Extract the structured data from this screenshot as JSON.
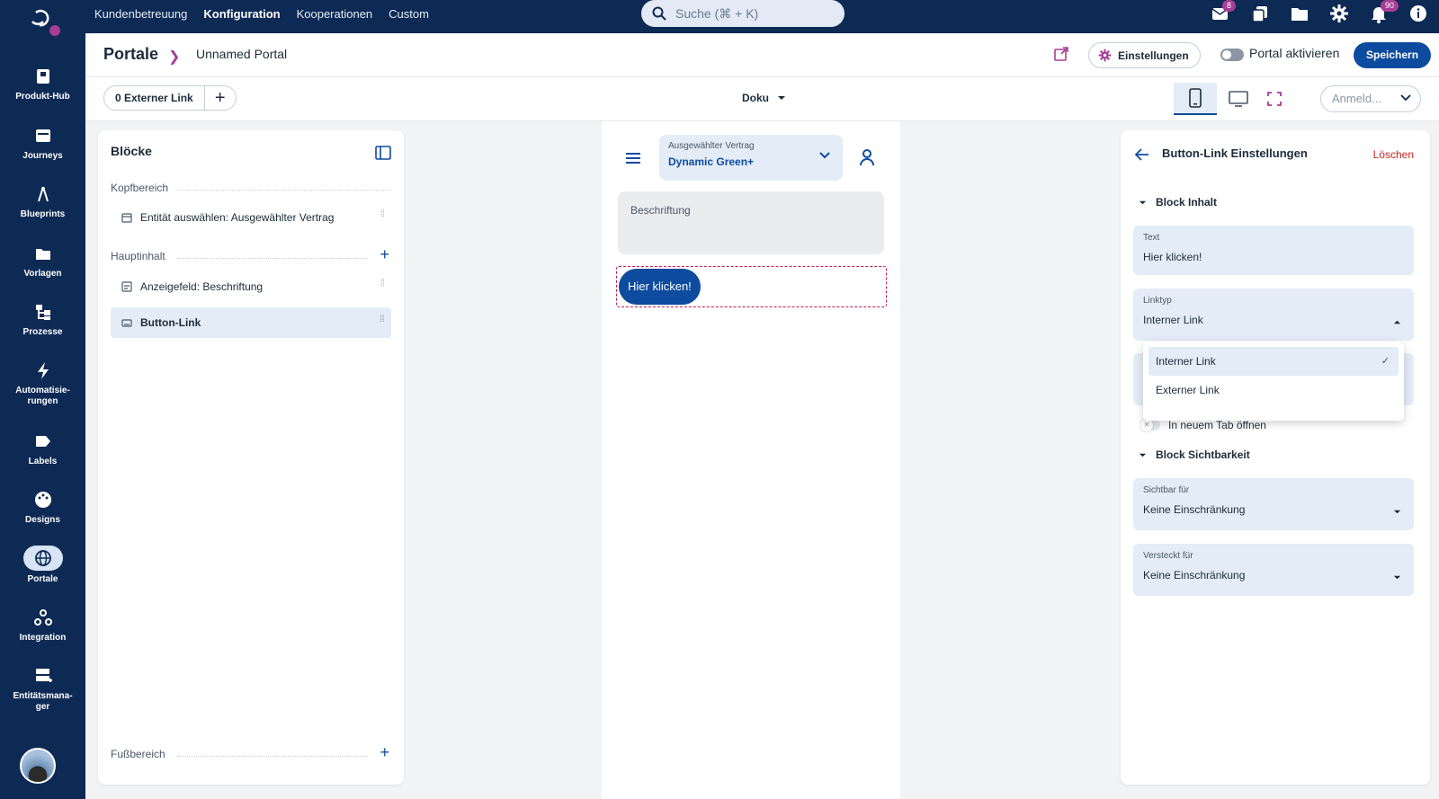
{
  "topnav": {
    "menu": [
      "Kundenbetreuung",
      "Konfiguration",
      "Kooperationen",
      "Custom"
    ],
    "active_index": 1,
    "search_placeholder": "Suche (⌘ + K)",
    "mail_badge": "8",
    "notification_badge": "90"
  },
  "sidebar": {
    "items": [
      {
        "label": "Produkt-Hub",
        "icon": "product-hub-icon"
      },
      {
        "label": "Journeys",
        "icon": "journeys-icon"
      },
      {
        "label": "Blueprints",
        "icon": "blueprints-icon"
      },
      {
        "label": "Vorlagen",
        "icon": "folder-icon"
      },
      {
        "label": "Prozesse",
        "icon": "processes-icon"
      },
      {
        "label": "Automatisie-rungen",
        "icon": "lightning-icon"
      },
      {
        "label": "Labels",
        "icon": "label-icon"
      },
      {
        "label": "Designs",
        "icon": "palette-icon"
      },
      {
        "label": "Portale",
        "icon": "globe-icon",
        "active": true
      },
      {
        "label": "Integration",
        "icon": "webhook-icon"
      },
      {
        "label": "Entitätsmana-ger",
        "icon": "entity-manager-icon"
      }
    ]
  },
  "header": {
    "breadcrumb_root": "Portale",
    "breadcrumb_current": "Unnamed Portal",
    "settings_label": "Einstellungen",
    "activate_label": "Portal aktivieren",
    "save_label": "Speichern"
  },
  "toolbar": {
    "external_link_label": "0 Externer Link",
    "doku_label": "Doku",
    "login_placeholder": "Anmeld..."
  },
  "blocks_panel": {
    "title": "Blöcke",
    "section_header": "Kopfbereich",
    "section_main": "Hauptinhalt",
    "section_footer": "Fußbereich",
    "header_items": [
      "Entität auswählen: Ausgewählter Vertrag"
    ],
    "main_items": [
      "Anzeigefeld: Beschriftung",
      "Button-Link"
    ]
  },
  "preview": {
    "contract_label": "Ausgewählter Vertrag",
    "contract_value": "Dynamic Green+",
    "caption": "Beschriftung",
    "button_text": "Hier klicken!"
  },
  "settings_panel": {
    "title": "Button-Link Einstellungen",
    "delete_label": "Löschen",
    "group_content": "Block Inhalt",
    "text_label": "Text",
    "text_value": "Hier klicken!",
    "linktype_label": "Linktyp",
    "linktype_value": "Interner Link",
    "linktype_options": [
      "Interner Link",
      "Externer Link"
    ],
    "new_tab_label": "In neuem Tab öffnen",
    "group_visibility": "Block Sichtbarkeit",
    "visible_for_label": "Sichtbar für",
    "visible_for_value": "Keine Einschränkung",
    "hidden_for_label": "Versteckt für",
    "hidden_for_value": "Keine Einschränkung"
  },
  "colors": {
    "nav_bg": "#0d2a55",
    "primary": "#0d4b9e",
    "accent": "#a63d97",
    "danger": "#c62828"
  }
}
